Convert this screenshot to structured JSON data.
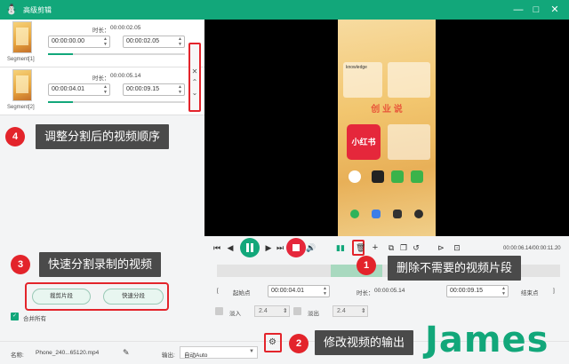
{
  "window": {
    "title": "高级剪辑",
    "min": "—",
    "max": "□",
    "close": "✕"
  },
  "segments": [
    {
      "label": "Segment[1]",
      "duration_label": "时长：",
      "duration": "00:00:02.05",
      "start": "00:00:00.00",
      "end": "00:00:02.05"
    },
    {
      "label": "Segment[2]",
      "duration_label": "时长：",
      "duration": "00:00:05.14",
      "start": "00:00:04.01",
      "end": "00:00:09.15"
    }
  ],
  "callouts": [
    {
      "num": "4",
      "text": "调整分割后的视频顺序"
    },
    {
      "num": "3",
      "text": "快速分割录制的视频"
    },
    {
      "num": "1",
      "text": "删除不需要的视频片段"
    },
    {
      "num": "2",
      "text": "修改视频的输出"
    }
  ],
  "buttons": {
    "split_segment": "裁剪片段",
    "quick_split": "快速分段"
  },
  "merge_all": "合并所有",
  "phone_screen": {
    "widget_title": "knowledge",
    "banner": "创 业 说",
    "app_label": "小红书"
  },
  "playback": {
    "time": "00:00:06.14/00:00:11.20"
  },
  "clip": {
    "start_label": "起始点",
    "start": "00:00:04.01",
    "duration_label": "时长：",
    "duration": "00:00:05.14",
    "end": "00:00:09.15",
    "end_label": "结束点"
  },
  "fade": {
    "in_label": "淡入",
    "in_value": "2.4",
    "out_label": "淡出",
    "out_value": "2.4"
  },
  "bottom": {
    "name_label": "名称:",
    "filename": "Phone_240...65120.mp4",
    "output_label": "输出:",
    "output_value": "自动Auto"
  },
  "watermark": "James",
  "colors": {
    "accent": "#12a77a",
    "highlight": "#e3242b",
    "callout_bg": "#4a4a4a"
  }
}
